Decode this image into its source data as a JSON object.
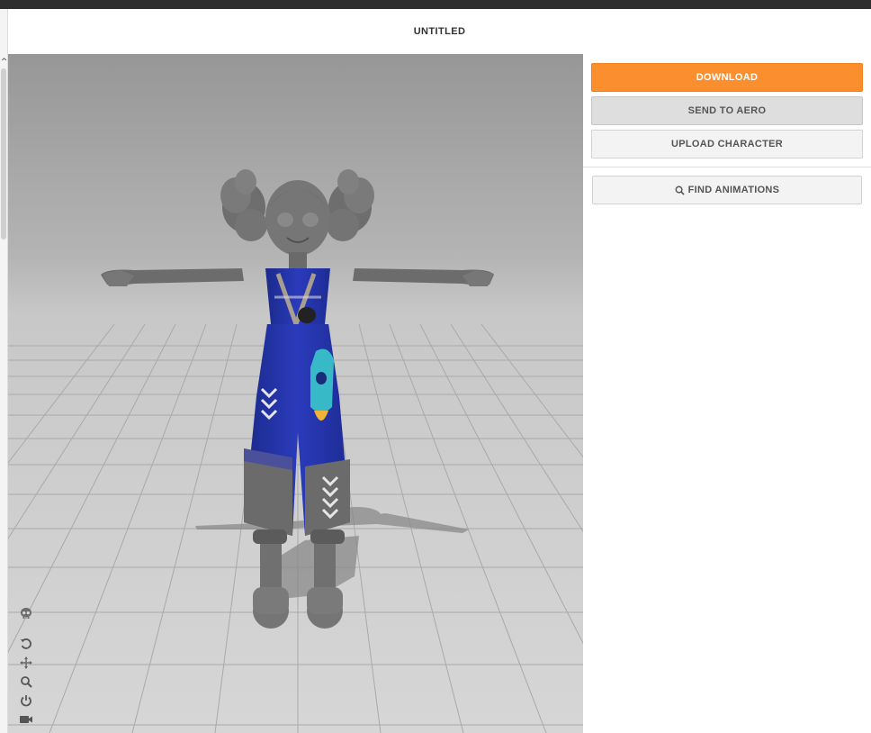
{
  "app": {
    "title": "UNTITLED"
  },
  "sidebar": {
    "download_label": "DOWNLOAD",
    "send_to_aero_label": "SEND TO AERO",
    "upload_character_label": "UPLOAD CHARACTER",
    "find_animations_label": "FIND ANIMATIONS",
    "find_animations_icon": "search-icon"
  },
  "viewport_tools": [
    {
      "icon": "skeleton-skull-icon"
    },
    {
      "icon": "reset-rotate-icon"
    },
    {
      "icon": "pan-move-icon"
    },
    {
      "icon": "zoom-icon"
    },
    {
      "icon": "power-icon"
    },
    {
      "icon": "camera-icon"
    }
  ],
  "colors": {
    "accent": "#fb8f2e",
    "top_bar": "#2f2f2f",
    "outfit_blue": "#2333a8"
  }
}
